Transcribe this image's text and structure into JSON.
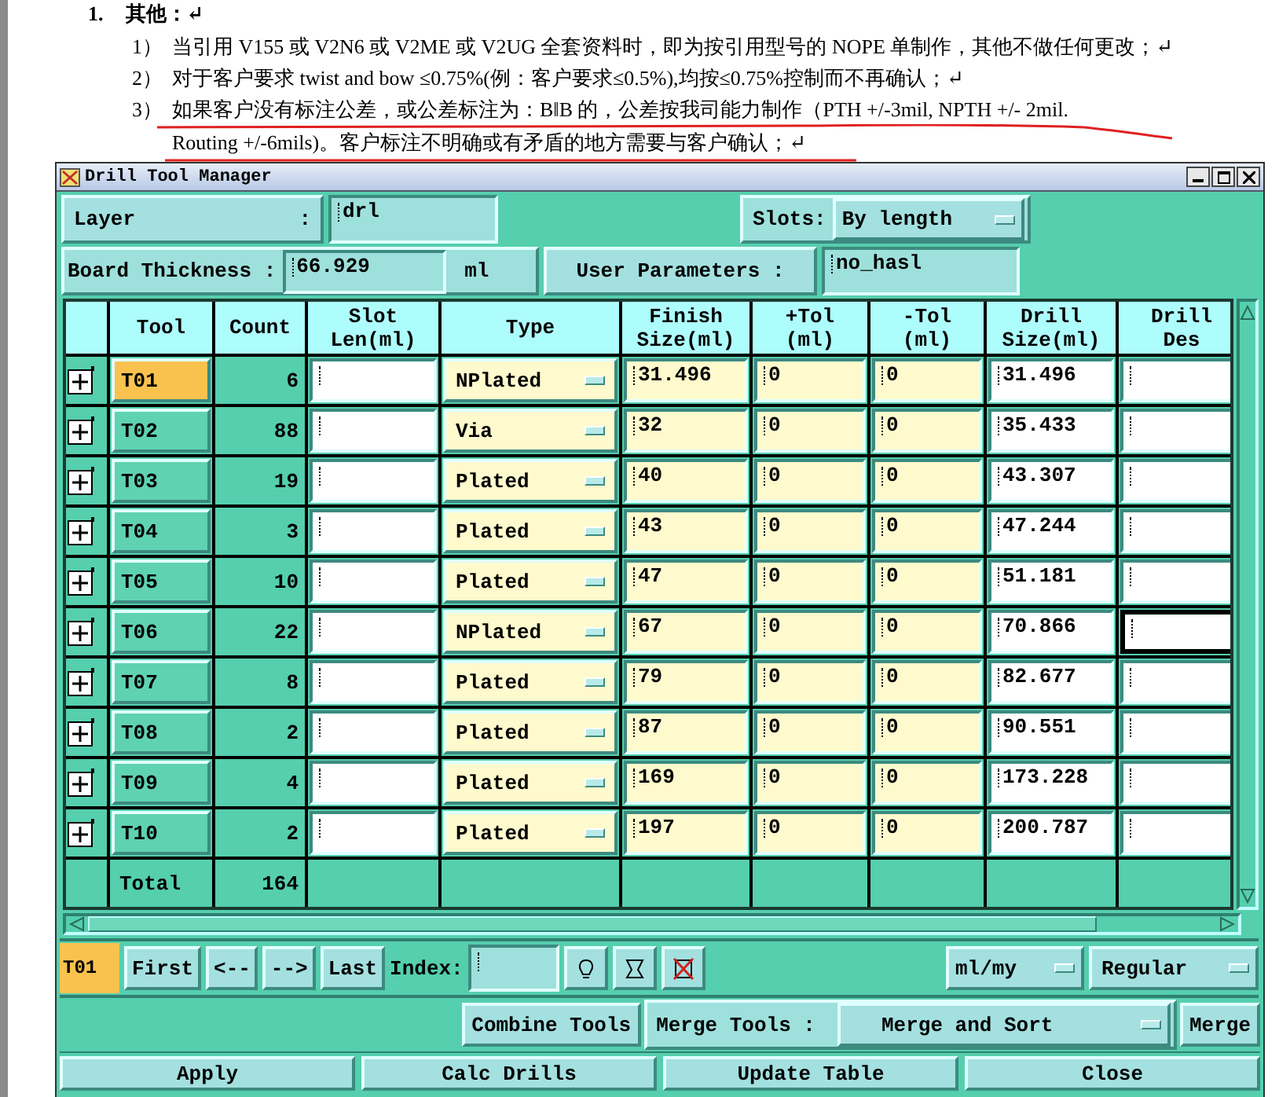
{
  "document": {
    "heading": {
      "number": "1.",
      "text": "其他：↵"
    },
    "items": [
      {
        "number": "1）",
        "lines": [
          "当引用 V155 或 V2N6 或 V2ME 或 V2UG 全套资料时，即为按引用型号的 NOPE 单制作，其他不做任何更改；↵"
        ]
      },
      {
        "number": "2）",
        "lines": [
          "对于客户要求 twist and bow ≤0.75%(例：客户要求≤0.5%),均按≤0.75%控制而不再确认；↵"
        ]
      },
      {
        "number": "3）",
        "lines": [
          "如果客户没有标注公差，或公差标注为：B‖B 的，公差按我司能力制作（PTH +/-3mil, NPTH +/- 2mil.",
          "Routing +/-6mils)。客户标注不明确或有矛盾的地方需要与客户确认；↵"
        ]
      }
    ]
  },
  "window": {
    "title": "Drill Tool Manager"
  },
  "layer": {
    "label": "Layer",
    "colon": ":",
    "value": "drl"
  },
  "slots": {
    "label": "Slots:",
    "value": "By length"
  },
  "board_thickness": {
    "label": "Board Thickness :",
    "value": "66.929",
    "unit": "ml"
  },
  "user_parameters": {
    "label": "User Parameters :",
    "value": "no_hasl"
  },
  "table": {
    "columns": [
      "Tool",
      "Count",
      "Slot\nLen(ml)",
      "Type",
      "Finish\nSize(ml)",
      "+Tol\n(ml)",
      "-Tol\n(ml)",
      "Drill\nSize(ml)",
      "Drill\nDes"
    ],
    "rows": [
      {
        "tool": "T01",
        "selected": true,
        "count": "6",
        "type": "NPlated",
        "finish": "31.496",
        "plus_tol": "0",
        "minus_tol": "0",
        "drill_size": "31.496",
        "des_focused": false
      },
      {
        "tool": "T02",
        "selected": false,
        "count": "88",
        "type": "Via",
        "finish": "32",
        "plus_tol": "0",
        "minus_tol": "0",
        "drill_size": "35.433",
        "des_focused": false
      },
      {
        "tool": "T03",
        "selected": false,
        "count": "19",
        "type": "Plated",
        "finish": "40",
        "plus_tol": "0",
        "minus_tol": "0",
        "drill_size": "43.307",
        "des_focused": false
      },
      {
        "tool": "T04",
        "selected": false,
        "count": "3",
        "type": "Plated",
        "finish": "43",
        "plus_tol": "0",
        "minus_tol": "0",
        "drill_size": "47.244",
        "des_focused": false
      },
      {
        "tool": "T05",
        "selected": false,
        "count": "10",
        "type": "Plated",
        "finish": "47",
        "plus_tol": "0",
        "minus_tol": "0",
        "drill_size": "51.181",
        "des_focused": false
      },
      {
        "tool": "T06",
        "selected": false,
        "count": "22",
        "type": "NPlated",
        "finish": "67",
        "plus_tol": "0",
        "minus_tol": "0",
        "drill_size": "70.866",
        "des_focused": true
      },
      {
        "tool": "T07",
        "selected": false,
        "count": "8",
        "type": "Plated",
        "finish": "79",
        "plus_tol": "0",
        "minus_tol": "0",
        "drill_size": "82.677",
        "des_focused": false
      },
      {
        "tool": "T08",
        "selected": false,
        "count": "2",
        "type": "Plated",
        "finish": "87",
        "plus_tol": "0",
        "minus_tol": "0",
        "drill_size": "90.551",
        "des_focused": false
      },
      {
        "tool": "T09",
        "selected": false,
        "count": "4",
        "type": "Plated",
        "finish": "169",
        "plus_tol": "0",
        "minus_tol": "0",
        "drill_size": "173.228",
        "des_focused": false
      },
      {
        "tool": "T10",
        "selected": false,
        "count": "2",
        "type": "Plated",
        "finish": "197",
        "plus_tol": "0",
        "minus_tol": "0",
        "drill_size": "200.787",
        "des_focused": false
      }
    ],
    "total_label": "Total",
    "total_count": "164"
  },
  "toolbar": {
    "current_tool": "T01",
    "nav_buttons": [
      "First",
      "<--",
      "-->",
      "Last"
    ],
    "index_label": "Index:",
    "units": "ml/my",
    "mode": "Regular"
  },
  "merge_bar": {
    "combine": "Combine Tools",
    "merge_label": "Merge Tools :",
    "merge_mode": "Merge and Sort",
    "merge": "Merge"
  },
  "buttons": [
    "Apply",
    "Calc Drills",
    "Update Table",
    "Close"
  ]
}
